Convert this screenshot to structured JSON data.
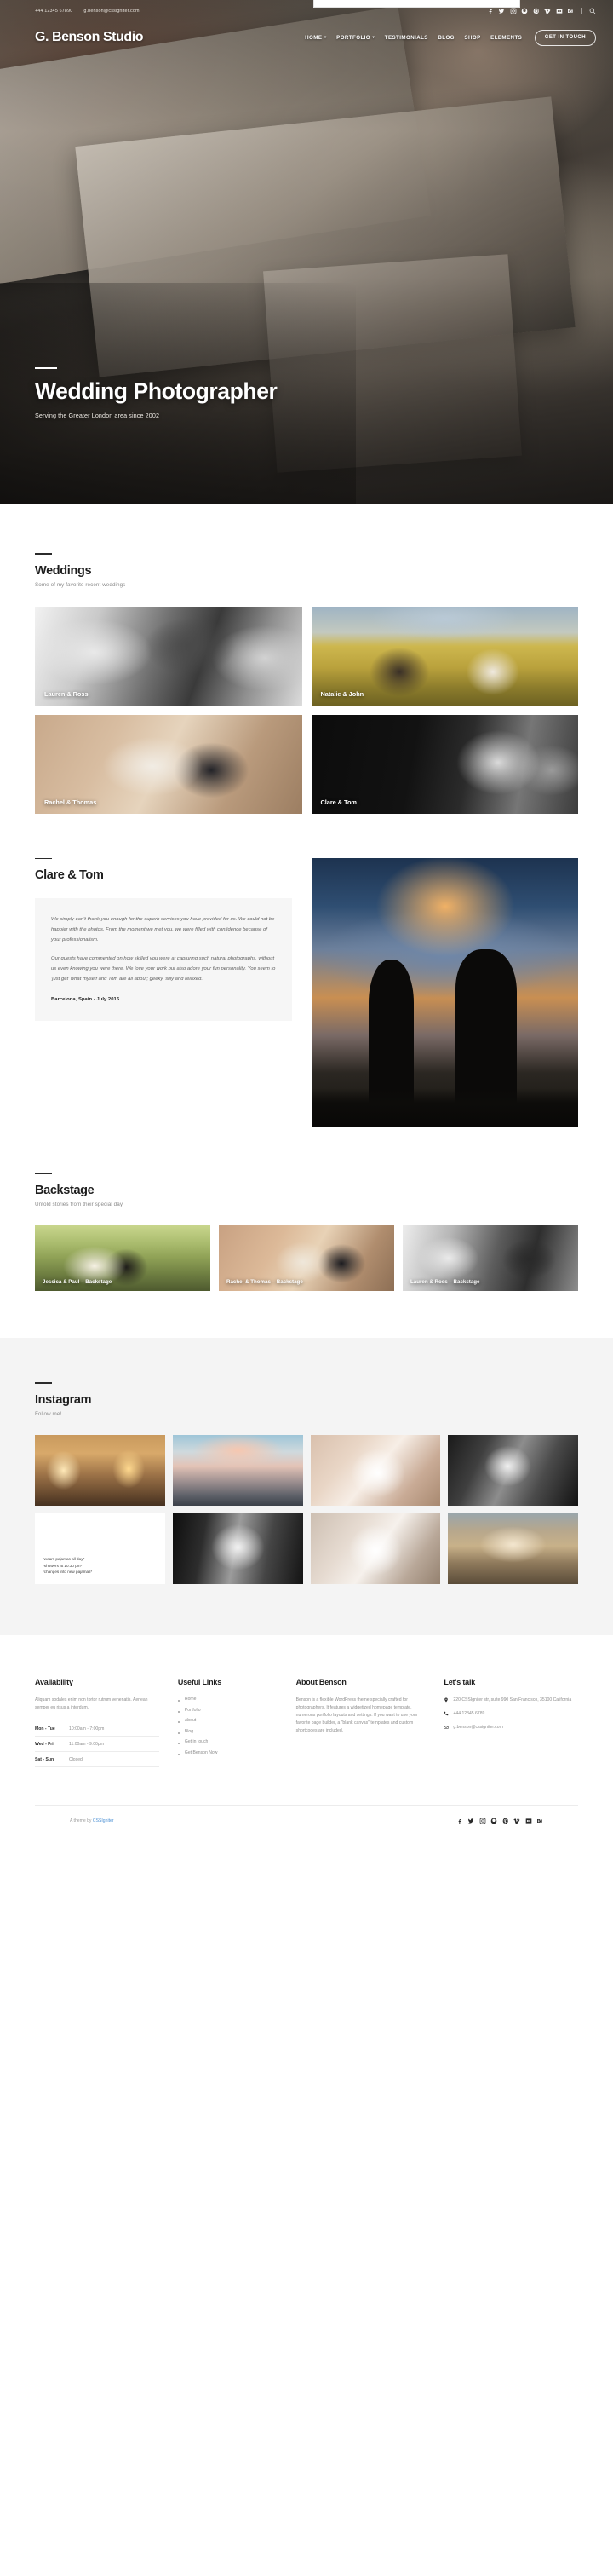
{
  "topbar": {
    "phone": "+44 12345 67890",
    "email": "g.benson@cssigniter.com",
    "social": [
      "facebook-icon",
      "twitter-icon",
      "instagram-icon",
      "google-plus-icon",
      "pinterest-icon",
      "vimeo-icon",
      "flickr-icon",
      "behance-icon"
    ],
    "search_icon": "search-icon"
  },
  "nav": {
    "brand": "G. Benson Studio",
    "items": [
      {
        "label": "Home",
        "has_dropdown": true
      },
      {
        "label": "Portfolio",
        "has_dropdown": true
      },
      {
        "label": "Testimonials",
        "has_dropdown": false
      },
      {
        "label": "Blog",
        "has_dropdown": false
      },
      {
        "label": "Shop",
        "has_dropdown": false
      },
      {
        "label": "Elements",
        "has_dropdown": false
      }
    ],
    "cta": "Get in touch"
  },
  "hero": {
    "title": "Wedding Photographer",
    "subtitle": "Serving the Greater London area since 2002"
  },
  "weddings": {
    "title": "Weddings",
    "subtitle": "Some of my favorite recent weddings",
    "cards": [
      {
        "caption": "Lauren & Ross"
      },
      {
        "caption": "Natalie & John"
      },
      {
        "caption": "Rachel & Thomas"
      },
      {
        "caption": "Clare & Tom"
      }
    ]
  },
  "testimonial": {
    "title": "Clare & Tom",
    "paragraphs": [
      "We simply can't thank you enough for the superb services you have provided for us. We could not be happier with the photos. From the moment we met you, we were filled with confidence because of your professionalism.",
      "Our guests have commented on how skilled you were at capturing such natural photographs, without us even knowing you were there. We love your work but also adore your fun personality. You seem to 'just get' what myself and Tom are all about; geeky, silly and relaxed."
    ],
    "meta": "Barcelona, Spain - July 2016"
  },
  "backstage": {
    "title": "Backstage",
    "subtitle": "Untold stories from their special day",
    "cards": [
      {
        "caption": "Jessica & Paul – Backstage"
      },
      {
        "caption": "Rachel & Thomas – Backstage"
      },
      {
        "caption": "Lauren & Ross – Backstage"
      }
    ]
  },
  "instagram": {
    "title": "Instagram",
    "subtitle": "Follow me!",
    "note_lines": [
      "*wears pajamas all day*",
      "*showers at 10:30 pm*",
      "*changes into new pajamas*"
    ]
  },
  "footer": {
    "availability": {
      "title": "Availability",
      "body": "Aliquam sodales enim non tortor rutrum venenatis. Aenean semper eu risus a interdum.",
      "hours": [
        {
          "day": "Mon - Tue",
          "time": "10:00am - 7:00pm"
        },
        {
          "day": "Wed - Fri",
          "time": "11:00am - 9:00pm"
        },
        {
          "day": "Sat - Sun",
          "time": "Closed"
        }
      ]
    },
    "useful_links": {
      "title": "Useful Links",
      "items": [
        "Home",
        "Portfolio",
        "About",
        "Blog",
        "Get in touch",
        "Get Benson Now"
      ]
    },
    "about": {
      "title": "About Benson",
      "body": "Benson is a flexible WordPress theme specially crafted for photographers. It features a widgetized homepage template, numerous portfolio layouts and settings. If you want to use your favorite page builder, a \"blank canvas\" templates and custom shortcodes are included."
    },
    "contact": {
      "title": "Let's talk",
      "address": "220 CSSIgniter str, suite 990 San Francisco, 35100 California",
      "phone": "+44 12345 6789",
      "email": "g.benson@cssigniter.com"
    }
  },
  "bottombar": {
    "credit_prefix": "A theme by ",
    "credit_link": "CSSIgniter",
    "social": [
      "facebook-icon",
      "twitter-icon",
      "instagram-icon",
      "google-plus-icon",
      "pinterest-icon",
      "vimeo-icon",
      "flickr-icon",
      "behance-icon"
    ]
  },
  "colors": {
    "accent_link": "#4a8fd4",
    "heading": "#1e1e1e",
    "muted": "#8d8d8d",
    "panel": "#f6f6f6",
    "insta_bg": "#f4f4f4"
  }
}
